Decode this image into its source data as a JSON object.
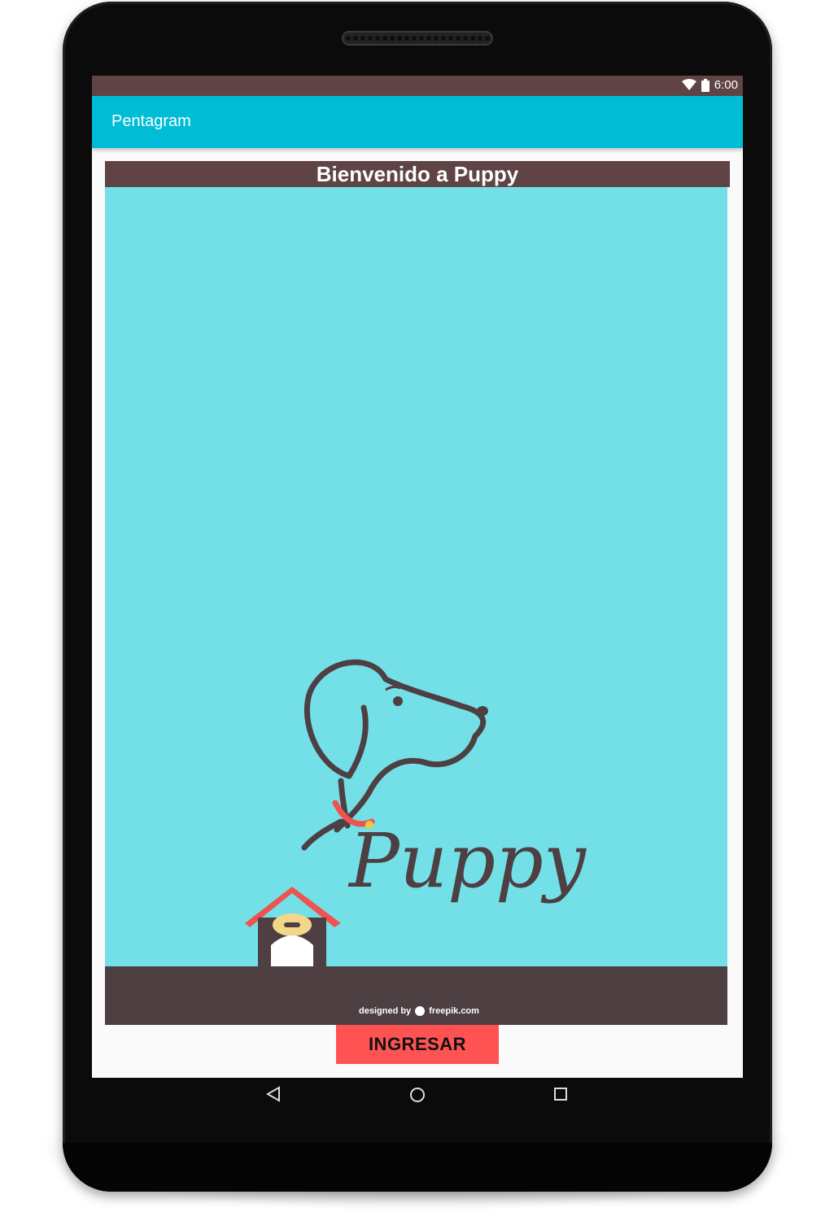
{
  "status_bar": {
    "time": "6:00"
  },
  "app_bar": {
    "title": "Pentagram"
  },
  "welcome": {
    "text": "Bienvenido a Puppy"
  },
  "illustration": {
    "logo_text": "Puppy",
    "credit_prefix": "designed by",
    "credit_site": "freepik.com"
  },
  "button": {
    "label": "INGRESAR"
  },
  "navigation": {
    "back": "back-icon",
    "home": "home-icon",
    "recents": "recents-icon"
  },
  "colors": {
    "status_bar": "#5f4345",
    "app_bar": "#00bcd4",
    "welcome_bar": "#5f4345",
    "illustration_bg": "#73e0e8",
    "button": "#ff5252"
  }
}
